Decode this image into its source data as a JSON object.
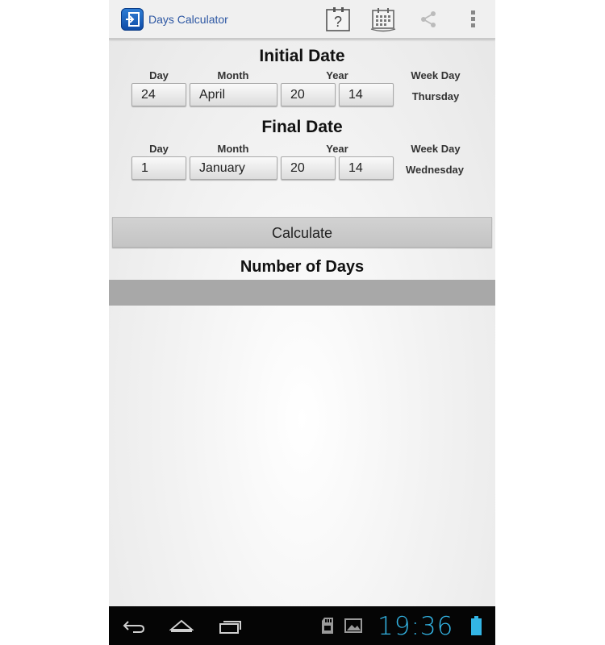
{
  "app": {
    "title": "Days Calculator"
  },
  "initial": {
    "title": "Initial Date",
    "labels": {
      "day": "Day",
      "month": "Month",
      "year": "Year",
      "weekday": "Week Day"
    },
    "day": "24",
    "month": "April",
    "century": "20",
    "year": "14",
    "weekday": "Thursday"
  },
  "final": {
    "title": "Final Date",
    "labels": {
      "day": "Day",
      "month": "Month",
      "year": "Year",
      "weekday": "Week Day"
    },
    "day": "1",
    "month": "January",
    "century": "20",
    "year": "14",
    "weekday": "Wednesday"
  },
  "calculate_label": "Calculate",
  "result": {
    "title": "Number of Days",
    "value": ""
  },
  "status": {
    "time": "19:36"
  },
  "icons": {
    "app": "app-launch-icon",
    "help": "help-icon",
    "calendar": "calendar-icon",
    "share": "share-icon",
    "overflow": "overflow-menu-icon",
    "back": "back-icon",
    "home": "home-icon",
    "recents": "recents-icon",
    "sdcard": "sd-card-icon",
    "gallery": "gallery-icon",
    "battery": "battery-icon"
  },
  "colors": {
    "accent": "#33b5e5",
    "title": "#2d57a3"
  }
}
